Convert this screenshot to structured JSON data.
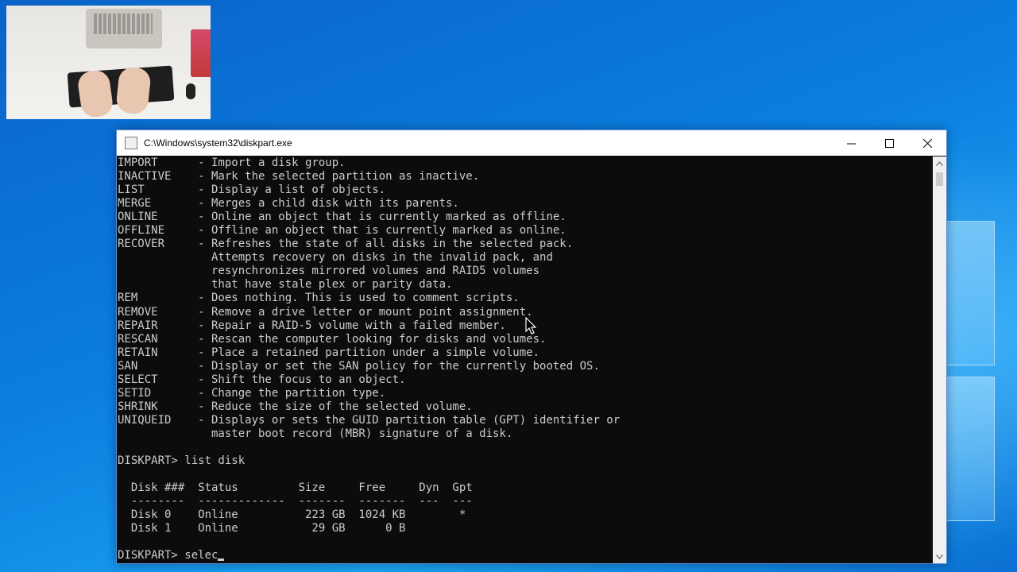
{
  "window": {
    "title": "C:\\Windows\\system32\\diskpart.exe",
    "controls": {
      "minimize_icon": "minimize-icon",
      "maximize_icon": "maximize-icon",
      "close_icon": "close-icon"
    }
  },
  "console": {
    "lines": [
      "IMPORT      - Import a disk group.",
      "INACTIVE    - Mark the selected partition as inactive.",
      "LIST        - Display a list of objects.",
      "MERGE       - Merges a child disk with its parents.",
      "ONLINE      - Online an object that is currently marked as offline.",
      "OFFLINE     - Offline an object that is currently marked as online.",
      "RECOVER     - Refreshes the state of all disks in the selected pack.",
      "              Attempts recovery on disks in the invalid pack, and",
      "              resynchronizes mirrored volumes and RAID5 volumes",
      "              that have stale plex or parity data.",
      "REM         - Does nothing. This is used to comment scripts.",
      "REMOVE      - Remove a drive letter or mount point assignment.",
      "REPAIR      - Repair a RAID-5 volume with a failed member.",
      "RESCAN      - Rescan the computer looking for disks and volumes.",
      "RETAIN      - Place a retained partition under a simple volume.",
      "SAN         - Display or set the SAN policy for the currently booted OS.",
      "SELECT      - Shift the focus to an object.",
      "SETID       - Change the partition type.",
      "SHRINK      - Reduce the size of the selected volume.",
      "UNIQUEID    - Displays or sets the GUID partition table (GPT) identifier or",
      "              master boot record (MBR) signature of a disk.",
      "",
      "DISKPART> list disk",
      "",
      "  Disk ###  Status         Size     Free     Dyn  Gpt",
      "  --------  -------------  -------  -------  ---  ---",
      "  Disk 0    Online          223 GB  1024 KB        *",
      "  Disk 1    Online           29 GB      0 B",
      ""
    ],
    "prompt": "DISKPART> ",
    "current_input": "selec"
  }
}
